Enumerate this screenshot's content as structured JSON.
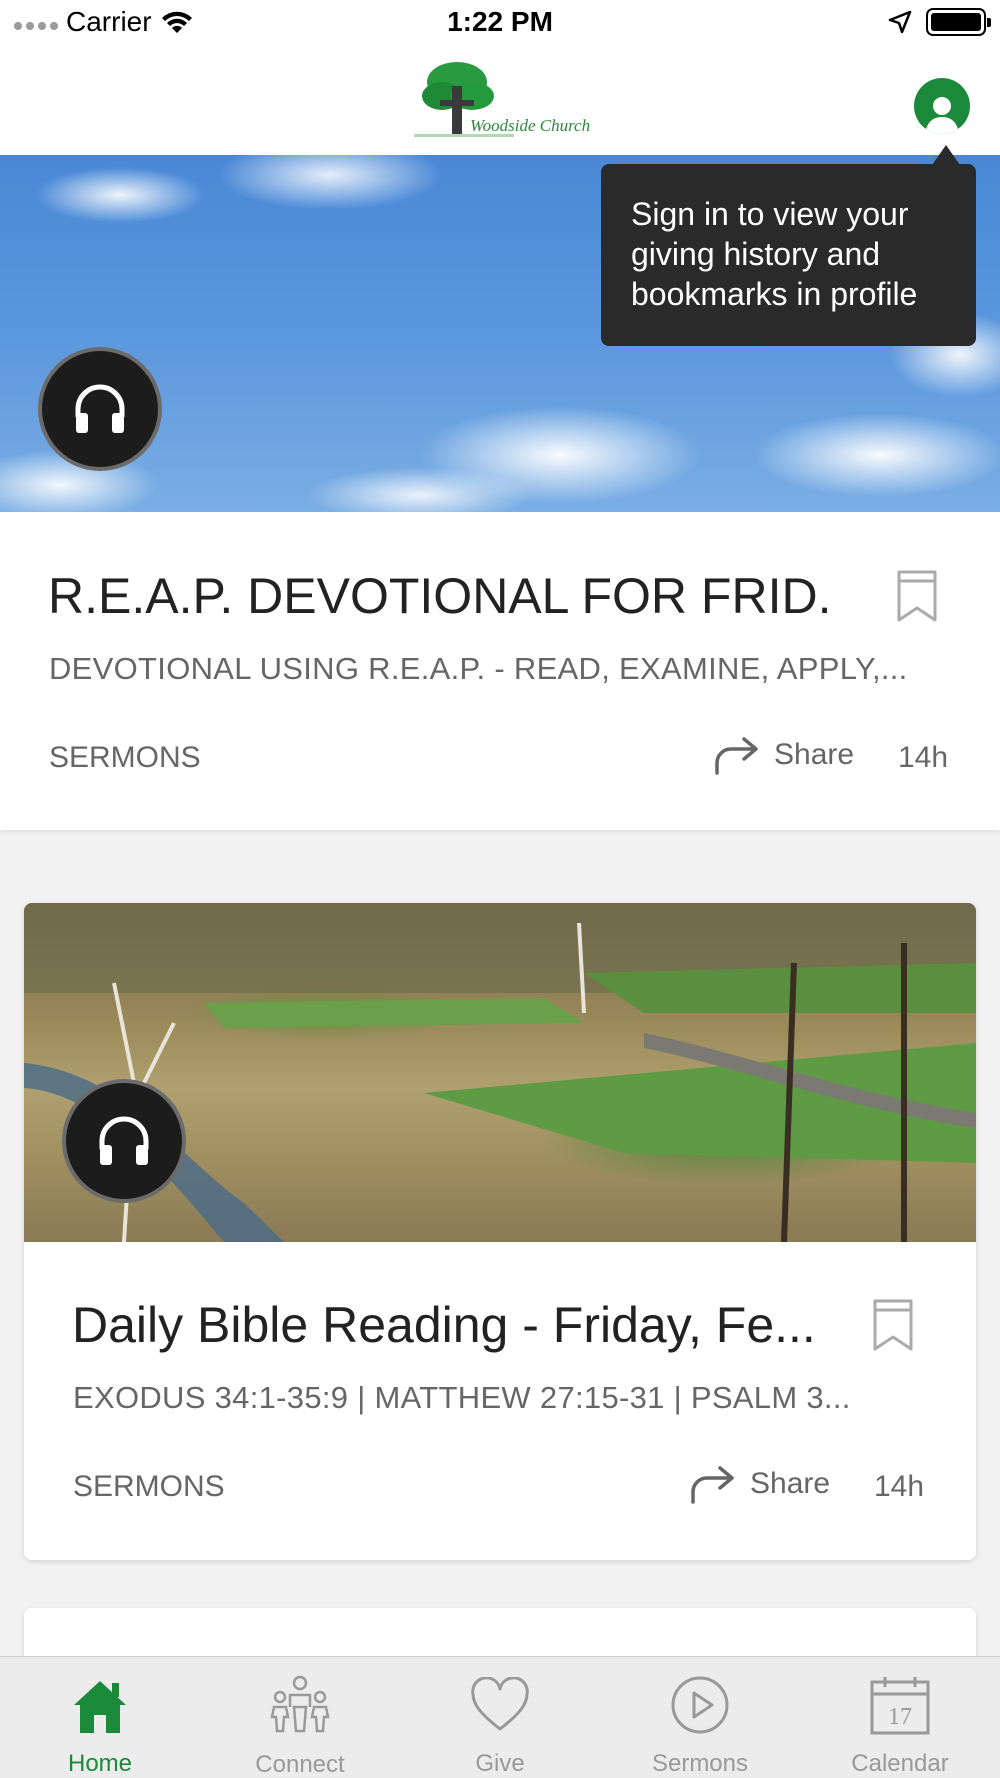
{
  "status_bar": {
    "carrier": "Carrier",
    "time": "1:22 PM"
  },
  "header": {
    "logo_text": "Woodside Church",
    "profile_icon": "person-icon",
    "brand_color": "#1a8a3a"
  },
  "tooltip": {
    "text_line1": "Sign in to view your",
    "text_line2": "giving history and",
    "text_line3": "bookmarks in profile"
  },
  "feed": [
    {
      "title": "R.E.A.P. DEVOTIONAL FOR FRID...",
      "subtitle": "DEVOTIONAL USING R.E.A.P. - READ, EXAMINE, APPLY,...",
      "category": "SERMONS",
      "share_label": "Share",
      "age": "14h",
      "media_icon": "headphones-icon"
    },
    {
      "title": "Daily Bible Reading - Friday, Fe...",
      "subtitle": "EXODUS 34:1-35:9 | MATTHEW 27:15-31 | PSALM 3...",
      "category": "SERMONS",
      "share_label": "Share",
      "age": "14h",
      "media_icon": "headphones-icon"
    }
  ],
  "tabs": [
    {
      "label": "Home",
      "icon": "home-icon",
      "active": true
    },
    {
      "label": "Connect",
      "icon": "people-icon",
      "active": false
    },
    {
      "label": "Give",
      "icon": "heart-icon",
      "active": false
    },
    {
      "label": "Sermons",
      "icon": "play-circle-icon",
      "active": false
    },
    {
      "label": "Calendar",
      "icon": "calendar-icon",
      "active": false,
      "calendar_day": "17"
    }
  ]
}
